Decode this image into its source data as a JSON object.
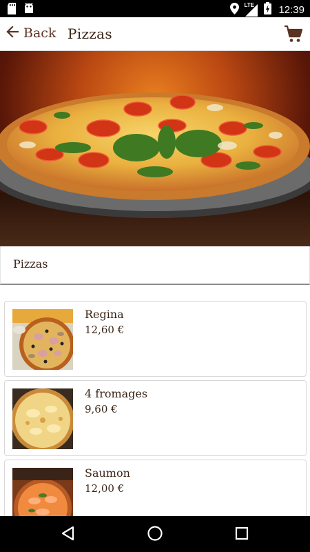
{
  "status_bar": {
    "time": "12:39",
    "network_label": "LTE",
    "icons": [
      "sd-card-icon",
      "android-icon",
      "location-icon",
      "signal-icon",
      "battery-charging-icon"
    ]
  },
  "app_bar": {
    "back_label": "Back",
    "title": "Pizzas",
    "cart_icon": "cart-icon"
  },
  "category": {
    "label": "Pizzas"
  },
  "products": [
    {
      "name": "Regina",
      "price": "12,60 €"
    },
    {
      "name": "4 fromages",
      "price": "9,60 €"
    },
    {
      "name": "Saumon",
      "price": "12,00 €"
    }
  ],
  "nav_bar": {
    "icons": [
      "back-triangle-icon",
      "home-circle-icon",
      "recents-square-icon"
    ]
  },
  "colors": {
    "accent": "#5a3322",
    "text": "#3a2417",
    "hero_glow": "#e9801f"
  }
}
